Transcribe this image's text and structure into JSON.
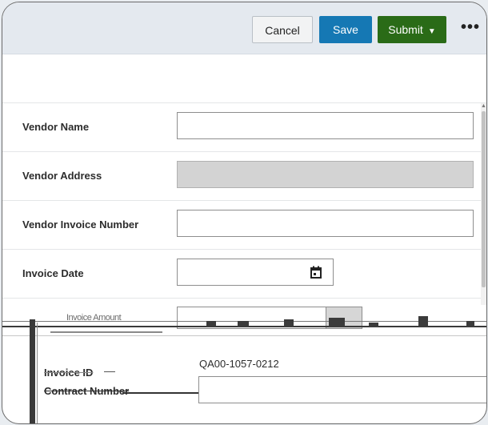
{
  "toolbar": {
    "cancel_label": "Cancel",
    "save_label": "Save",
    "submit_label": "Submit",
    "submit_caret": "▼",
    "more_label": "•••"
  },
  "form": {
    "rows": [
      {
        "label": "Vendor Name",
        "value": ""
      },
      {
        "label": "Vendor Address",
        "value": ""
      },
      {
        "label": "Vendor Invoice Number",
        "value": ""
      },
      {
        "label": "Invoice Date",
        "value": ""
      }
    ],
    "glitched_label": "Invoice Amount",
    "invoice_id_label": "Invoice ID",
    "invoice_id_value": "QA00-1057-0212",
    "contract_number_label": "Contract Number",
    "contract_number_value": ""
  },
  "colors": {
    "toolbar_bg": "#e4e9ef",
    "save": "#1578b4",
    "submit": "#2a6b17",
    "readonly_field": "#d3d3d3"
  },
  "icons": [
    "calendar-icon",
    "caret-down-icon",
    "more-icon"
  ]
}
